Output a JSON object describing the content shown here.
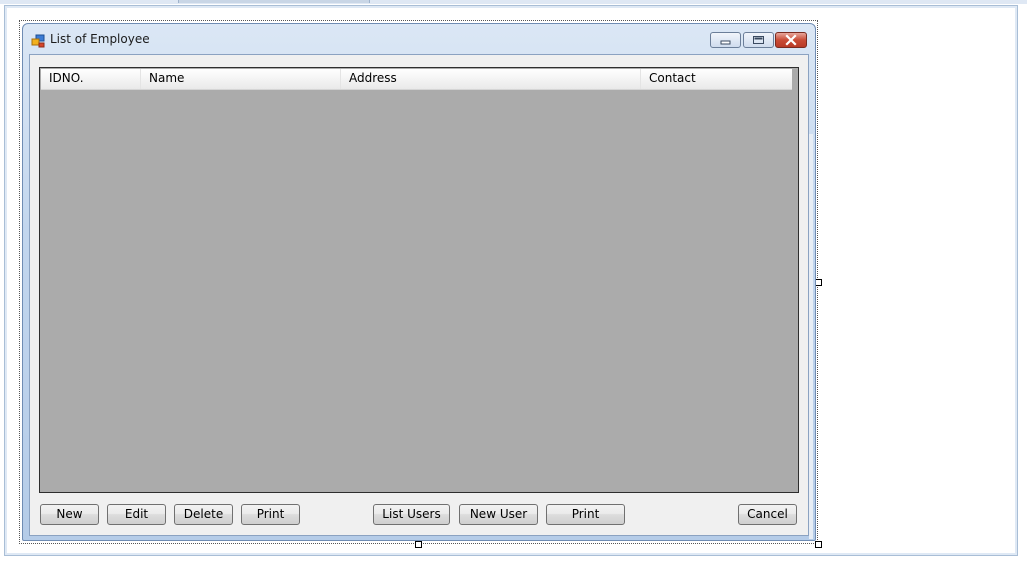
{
  "form": {
    "title": "List of Employee",
    "icon": "form-app-icon",
    "caption_buttons": [
      "minimize-icon",
      "maximize-icon",
      "close-icon"
    ]
  },
  "grid": {
    "columns": [
      "IDNO.",
      "Name",
      "Address",
      "Contact"
    ],
    "rows": [],
    "background_color": "#ababab"
  },
  "buttons": {
    "new": "New",
    "edit": "Edit",
    "delete": "Delete",
    "print": "Print",
    "list_users": "List Users",
    "new_user": "New User",
    "print_users": "Print",
    "cancel": "Cancel"
  }
}
